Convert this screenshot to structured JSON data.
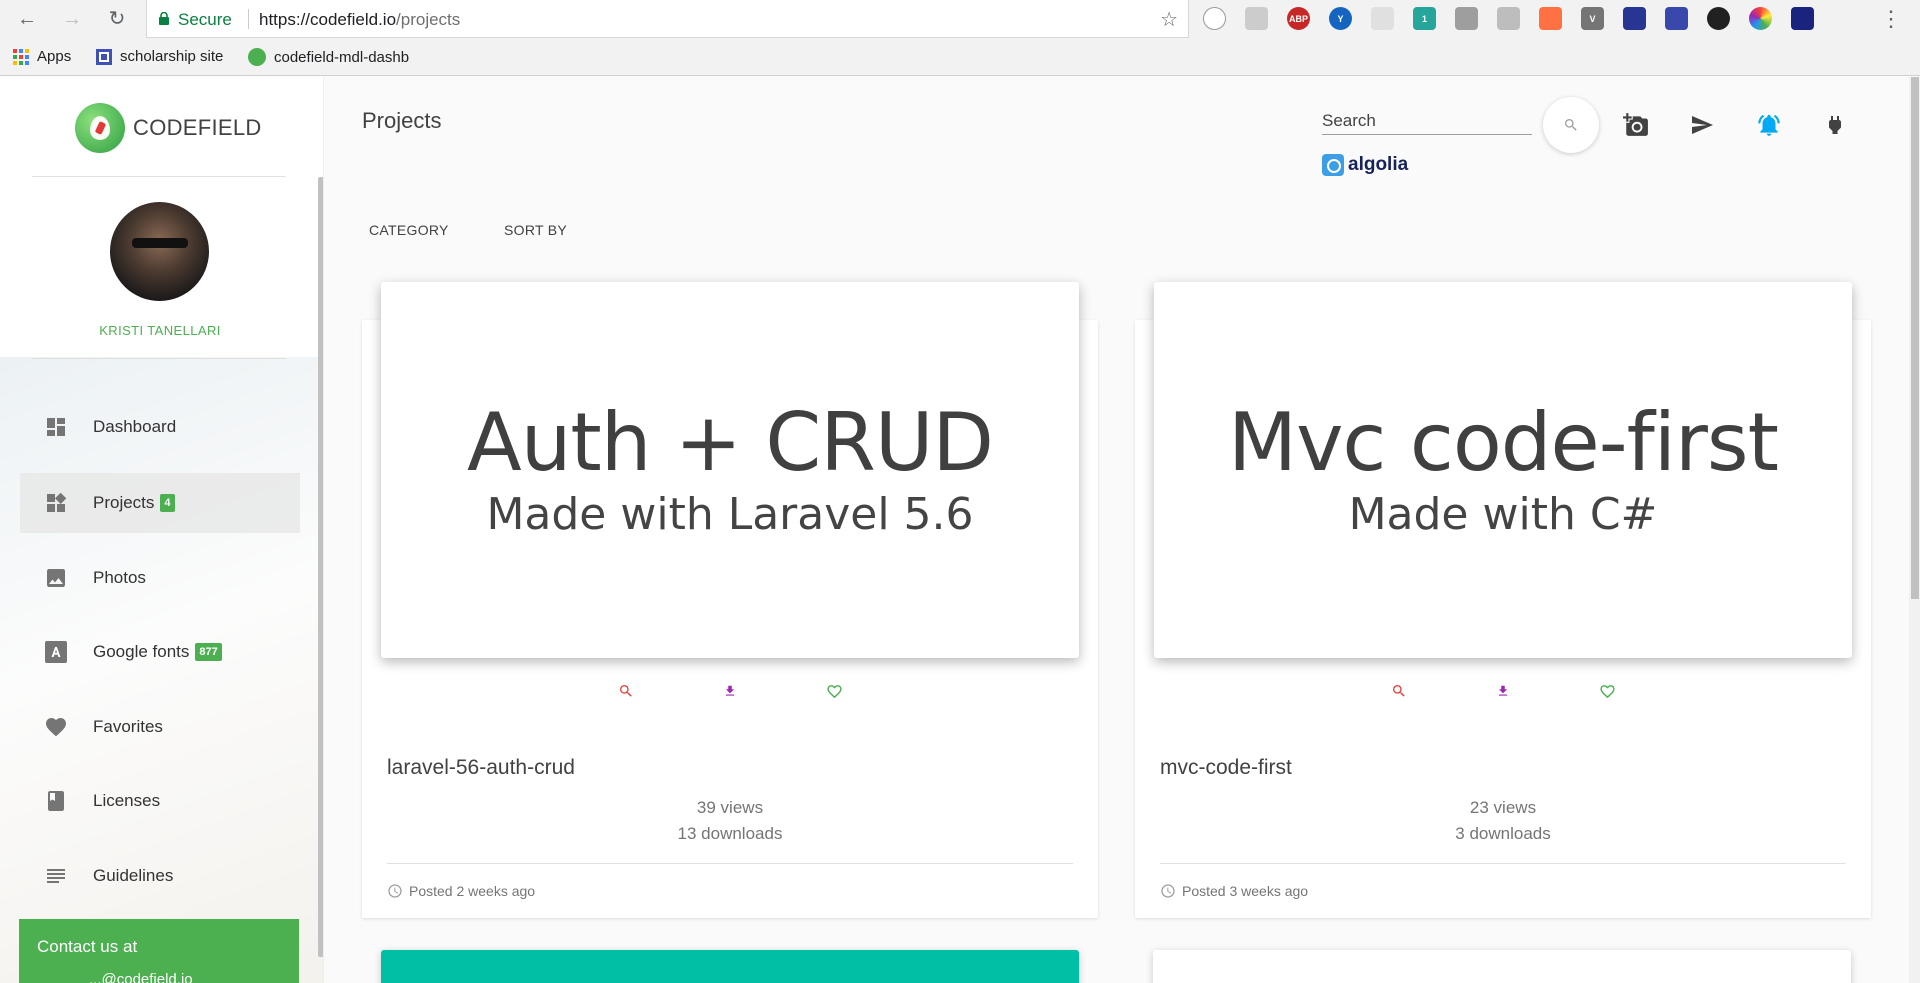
{
  "browser": {
    "secure_label": "Secure",
    "url_host": "https://codefield.io",
    "url_path": "/projects",
    "bookmarks": [
      {
        "label": "Apps"
      },
      {
        "label": "scholarship site"
      },
      {
        "label": "codefield-mdl-dashb"
      }
    ]
  },
  "sidebar": {
    "brand": "CODEFIELD",
    "user_name": "KRISTI TANELLARI",
    "items": [
      {
        "label": "Dashboard",
        "icon": "dashboard-icon"
      },
      {
        "label": "Projects",
        "icon": "projects-icon",
        "badge": "4",
        "active": true
      },
      {
        "label": "Photos",
        "icon": "photo-icon"
      },
      {
        "label": "Google fonts",
        "icon": "font-icon",
        "badge": "877"
      },
      {
        "label": "Favorites",
        "icon": "heart-icon"
      },
      {
        "label": "Licenses",
        "icon": "book-icon"
      },
      {
        "label": "Guidelines",
        "icon": "lines-icon"
      }
    ],
    "contact_label": "Contact us at",
    "contact_email": "...@codefield.io"
  },
  "main": {
    "title": "Projects",
    "search_placeholder": "Search",
    "algolia_label": "algolia",
    "filters": {
      "category": "CATEGORY",
      "sort": "SORT BY"
    },
    "cards": [
      {
        "image_title": "Auth + CRUD",
        "image_subtitle": "Made with Laravel 5.6",
        "name": "laravel-56-auth-crud",
        "views": "39 views",
        "downloads": "13 downloads",
        "posted": "Posted 2 weeks ago"
      },
      {
        "image_title": "Mvc code-first",
        "image_subtitle": "Made with C#",
        "name": "mvc-code-first",
        "views": "23 views",
        "downloads": "3 downloads",
        "posted": "Posted 3 weeks ago"
      }
    ]
  },
  "colors": {
    "accent_green": "#4caf50",
    "notification_blue": "#03a9f4",
    "action_search_red": "#e53935",
    "action_download_purple": "#9c27b0",
    "action_favorite_green": "#4caf50",
    "card3_teal": "#00bfa5"
  }
}
